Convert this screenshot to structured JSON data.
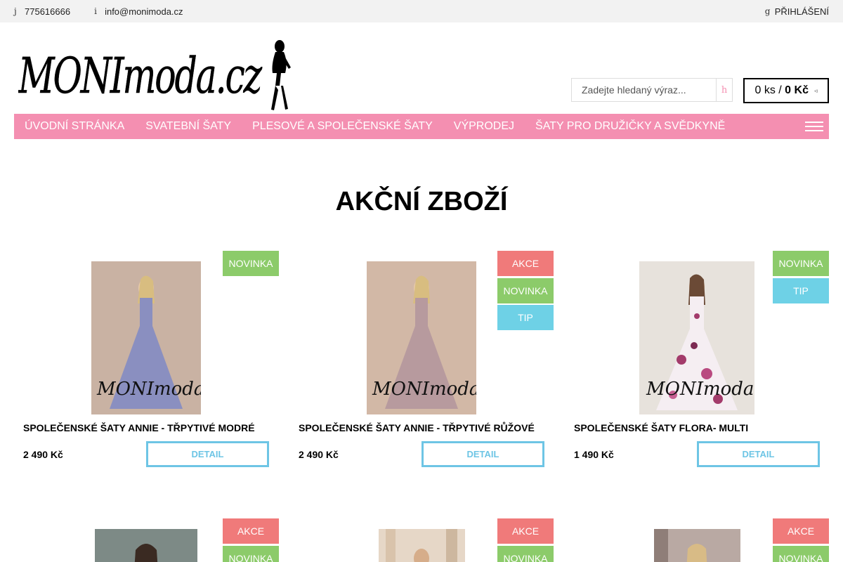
{
  "topbar": {
    "phone_icon": "phone-icon",
    "phone": "775616666",
    "email_icon": "info-icon",
    "email": "info@monimoda.cz",
    "login_icon": "user-icon",
    "login": "PŘIHLÁŠENÍ"
  },
  "header": {
    "logo_text": "MONImoda.cz",
    "search_placeholder": "Zadejte hledaný výraz...",
    "search_icon": "search-icon",
    "cart_count": "0 ks",
    "cart_sep": " / ",
    "cart_total": "0 Kč"
  },
  "nav": {
    "items": [
      "ÚVODNÍ STRÁNKA",
      "SVATEBNÍ ŠATY",
      "PLESOVÉ A SPOLEČENSKÉ ŠATY",
      "VÝPRODEJ",
      "ŠATY PRO DRUŽIČKY A SVĚDKYNĚ"
    ]
  },
  "section": {
    "title": "AKČNÍ ZBOŽÍ"
  },
  "products": [
    {
      "name": "SPOLEČENSKÉ ŠATY ANNIE - TŘPYTIVÉ MODRÉ",
      "price": "2 490 Kč",
      "detail": "DETAIL",
      "badges": [
        "NOVINKA"
      ],
      "dress_color": "#8a8fc0",
      "bg_color": "#c9b2a3"
    },
    {
      "name": "SPOLEČENSKÉ ŠATY ANNIE - TŘPYTIVÉ RŮŽOVÉ",
      "price": "2 490 Kč",
      "detail": "DETAIL",
      "badges": [
        "AKCE",
        "NOVINKA",
        "TIP"
      ],
      "dress_color": "#b79a9e",
      "bg_color": "#d2b8a6"
    },
    {
      "name": "SPOLEČENSKÉ ŠATY FLORA- MULTI",
      "price": "1 490 Kč",
      "detail": "DETAIL",
      "badges": [
        "NOVINKA",
        "TIP"
      ],
      "dress_color": "#f5eef2",
      "bg_color": "#e7e2dc"
    },
    {
      "badges": [
        "AKCE",
        "NOVINKA"
      ],
      "bg_color": "#7d8a86"
    },
    {
      "badges": [
        "AKCE",
        "NOVINKA"
      ],
      "bg_color": "#e6d7c7"
    },
    {
      "badges": [
        "AKCE",
        "NOVINKA"
      ],
      "bg_color": "#b9a9a3"
    }
  ],
  "colors": {
    "accent_pink": "#f48fb1",
    "akce": "#f07a7a",
    "novinka": "#8ccb6a",
    "tip": "#6ed1e6",
    "detail_border": "#6ec5e5"
  }
}
